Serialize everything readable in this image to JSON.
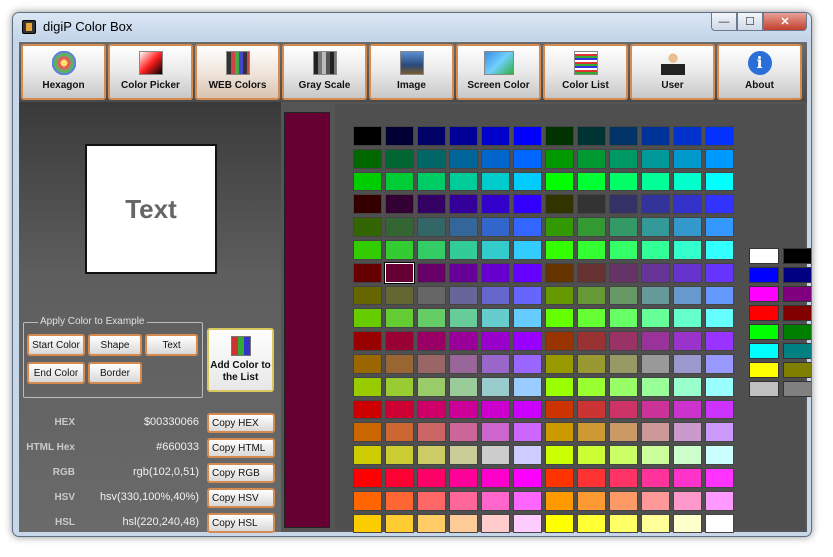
{
  "window": {
    "title": "digiP Color Box"
  },
  "caption": {
    "minimize": "—",
    "maximize": "☐",
    "close": "✕"
  },
  "toolbar": [
    {
      "label": "Hexagon",
      "icon": "hexagon-icon"
    },
    {
      "label": "Color Picker",
      "icon": "color-picker-icon"
    },
    {
      "label": "WEB Colors",
      "icon": "web-colors-icon",
      "active": true
    },
    {
      "label": "Gray Scale",
      "icon": "gray-scale-icon"
    },
    {
      "label": "Image",
      "icon": "image-icon"
    },
    {
      "label": "Screen Color",
      "icon": "screen-color-icon"
    },
    {
      "label": "Color List",
      "icon": "color-list-icon"
    },
    {
      "label": "User",
      "icon": "user-icon"
    },
    {
      "label": "About",
      "icon": "about-icon"
    }
  ],
  "preview": {
    "text": "Text",
    "text_color": "#666666",
    "background": "#ffffff"
  },
  "apply": {
    "legend": "Apply Color to Example",
    "start_color": "Start Color",
    "shape": "Shape",
    "text": "Text",
    "end_color": "End Color",
    "border": "Border"
  },
  "add_to_list": "Add Color to the List",
  "info": {
    "hex": {
      "label": "HEX",
      "value": "$00330066",
      "button": "Copy HEX"
    },
    "html": {
      "label": "HTML Hex",
      "value": "#660033",
      "button": "Copy HTML"
    },
    "rgb": {
      "label": "RGB",
      "value": "rgb(102,0,51)",
      "button": "Copy RGB"
    },
    "hsv": {
      "label": "HSV",
      "value": "hsv(330,100%,40%)",
      "button": "Copy HSV"
    },
    "hsl": {
      "label": "HSL",
      "value": "hsl(220,240,48)",
      "button": "Copy HSL"
    }
  },
  "selected_color": "#660033",
  "web_colors": [
    [
      "#000000",
      "#000033",
      "#000066",
      "#000099",
      "#0000cc",
      "#0000ff",
      "#003300",
      "#003333",
      "#003366",
      "#003399",
      "#0033cc",
      "#0033ff"
    ],
    [
      "#006600",
      "#006633",
      "#006666",
      "#006699",
      "#0066cc",
      "#0066ff",
      "#009900",
      "#009933",
      "#009966",
      "#009999",
      "#0099cc",
      "#0099ff"
    ],
    [
      "#00cc00",
      "#00cc33",
      "#00cc66",
      "#00cc99",
      "#00cccc",
      "#00ccff",
      "#00ff00",
      "#00ff33",
      "#00ff66",
      "#00ff99",
      "#00ffcc",
      "#00ffff"
    ],
    [
      "#330000",
      "#330033",
      "#330066",
      "#330099",
      "#3300cc",
      "#3300ff",
      "#333300",
      "#333333",
      "#333366",
      "#333399",
      "#3333cc",
      "#3333ff"
    ],
    [
      "#336600",
      "#336633",
      "#336666",
      "#336699",
      "#3366cc",
      "#3366ff",
      "#339900",
      "#339933",
      "#339966",
      "#339999",
      "#3399cc",
      "#3399ff"
    ],
    [
      "#33cc00",
      "#33cc33",
      "#33cc66",
      "#33cc99",
      "#33cccc",
      "#33ccff",
      "#33ff00",
      "#33ff33",
      "#33ff66",
      "#33ff99",
      "#33ffcc",
      "#33ffff"
    ],
    [
      "#660000",
      "#660033",
      "#660066",
      "#660099",
      "#6600cc",
      "#6600ff",
      "#663300",
      "#663333",
      "#663366",
      "#663399",
      "#6633cc",
      "#6633ff"
    ],
    [
      "#666600",
      "#666633",
      "#666666",
      "#666699",
      "#6666cc",
      "#6666ff",
      "#669900",
      "#669933",
      "#669966",
      "#669999",
      "#6699cc",
      "#6699ff"
    ],
    [
      "#66cc00",
      "#66cc33",
      "#66cc66",
      "#66cc99",
      "#66cccc",
      "#66ccff",
      "#66ff00",
      "#66ff33",
      "#66ff66",
      "#66ff99",
      "#66ffcc",
      "#66ffff"
    ],
    [
      "#990000",
      "#990033",
      "#990066",
      "#990099",
      "#9900cc",
      "#9900ff",
      "#993300",
      "#993333",
      "#993366",
      "#993399",
      "#9933cc",
      "#9933ff"
    ],
    [
      "#996600",
      "#996633",
      "#996666",
      "#996699",
      "#9966cc",
      "#9966ff",
      "#999900",
      "#999933",
      "#999966",
      "#999999",
      "#9999cc",
      "#9999ff"
    ],
    [
      "#99cc00",
      "#99cc33",
      "#99cc66",
      "#99cc99",
      "#99cccc",
      "#99ccff",
      "#99ff00",
      "#99ff33",
      "#99ff66",
      "#99ff99",
      "#99ffcc",
      "#99ffff"
    ],
    [
      "#cc0000",
      "#cc0033",
      "#cc0066",
      "#cc0099",
      "#cc00cc",
      "#cc00ff",
      "#cc3300",
      "#cc3333",
      "#cc3366",
      "#cc3399",
      "#cc33cc",
      "#cc33ff"
    ],
    [
      "#cc6600",
      "#cc6633",
      "#cc6666",
      "#cc6699",
      "#cc66cc",
      "#cc66ff",
      "#cc9900",
      "#cc9933",
      "#cc9966",
      "#cc9999",
      "#cc99cc",
      "#cc99ff"
    ],
    [
      "#cccc00",
      "#cccc33",
      "#cccc66",
      "#cccc99",
      "#cccccc",
      "#ccccff",
      "#ccff00",
      "#ccff33",
      "#ccff66",
      "#ccff99",
      "#ccffcc",
      "#ccffff"
    ],
    [
      "#ff0000",
      "#ff0033",
      "#ff0066",
      "#ff0099",
      "#ff00cc",
      "#ff00ff",
      "#ff3300",
      "#ff3333",
      "#ff3366",
      "#ff3399",
      "#ff33cc",
      "#ff33ff"
    ],
    [
      "#ff6600",
      "#ff6633",
      "#ff6666",
      "#ff6699",
      "#ff66cc",
      "#ff66ff",
      "#ff9900",
      "#ff9933",
      "#ff9966",
      "#ff9999",
      "#ff99cc",
      "#ff99ff"
    ],
    [
      "#ffcc00",
      "#ffcc33",
      "#ffcc66",
      "#ffcc99",
      "#ffcccc",
      "#ffccff",
      "#ffff00",
      "#ffff33",
      "#ffff66",
      "#ffff99",
      "#ffffcc",
      "#ffffff"
    ]
  ],
  "basic_colors": [
    "#ffffff",
    "#000000",
    "#0000ff",
    "#000080",
    "#ff00ff",
    "#800080",
    "#ff0000",
    "#800000",
    "#00ff00",
    "#008000",
    "#00ffff",
    "#008080",
    "#ffff00",
    "#808000",
    "#c0c0c0",
    "#808080"
  ]
}
